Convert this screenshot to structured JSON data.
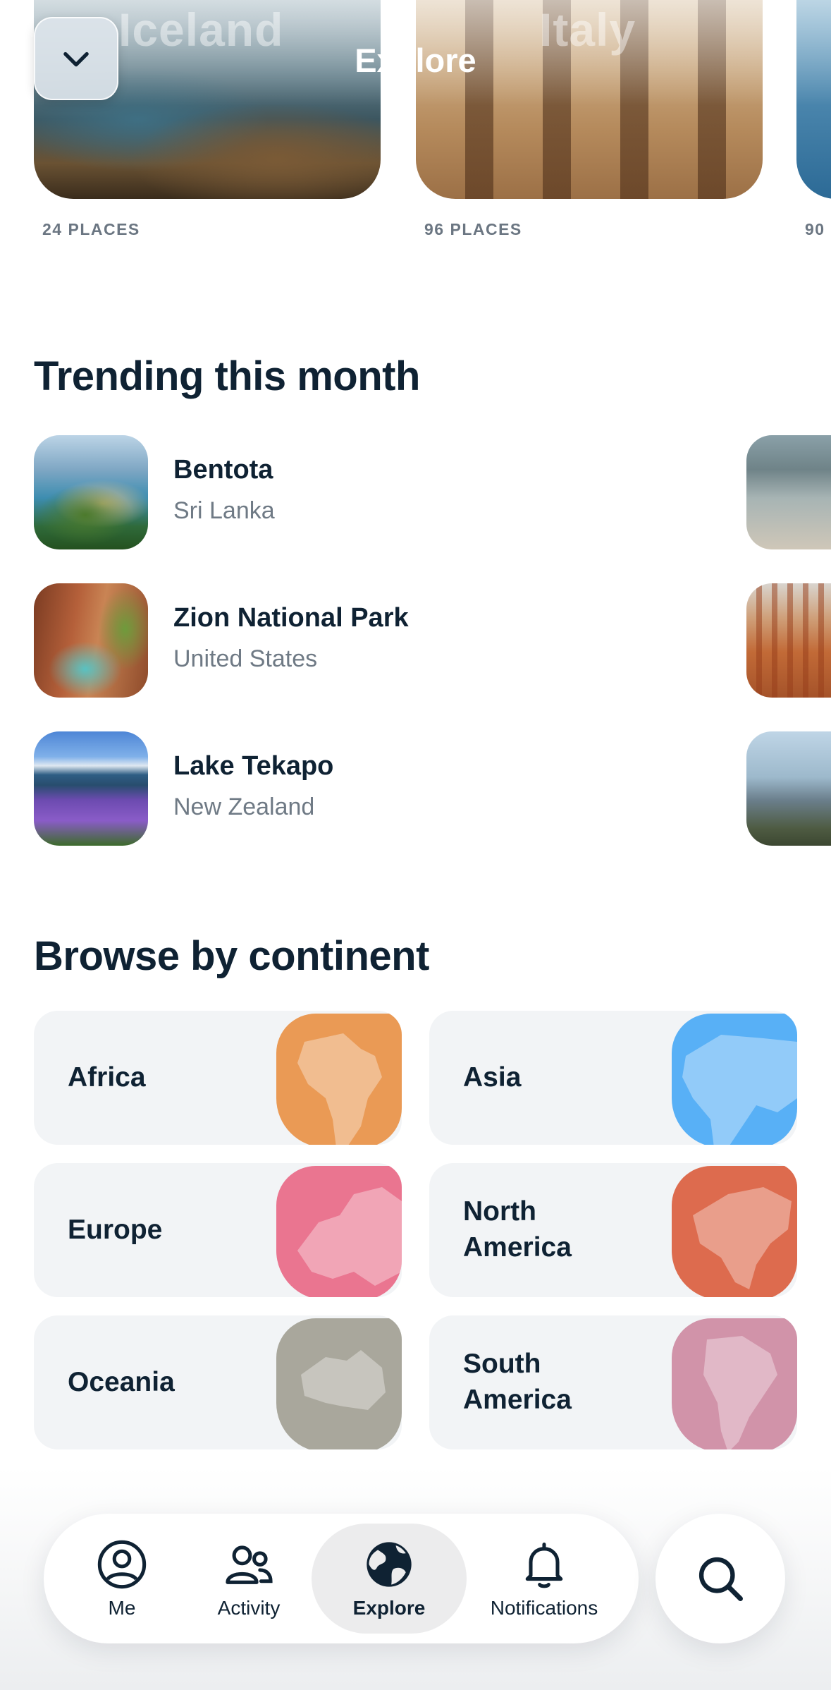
{
  "header": {
    "title": "Explore",
    "collapse_icon": "chevron-down-icon"
  },
  "countries": [
    {
      "name": "Iceland",
      "places": "24 PLACES"
    },
    {
      "name": "Italy",
      "places": "96 PLACES"
    },
    {
      "name": "",
      "places": "90"
    }
  ],
  "trending": {
    "heading": "Trending this month",
    "items": [
      {
        "name": "Bentota",
        "country": "Sri Lanka"
      },
      {
        "name": "Zion National Park",
        "country": "United States"
      },
      {
        "name": "Lake Tekapo",
        "country": "New Zealand"
      }
    ]
  },
  "continents": {
    "heading": "Browse by continent",
    "items": [
      {
        "label": "Africa",
        "color": "#ea9a55"
      },
      {
        "label": "Asia",
        "color": "#58b0f6"
      },
      {
        "label": "Europe",
        "color": "#ea7590"
      },
      {
        "label": "North America",
        "color": "#dd6b4e"
      },
      {
        "label": "Oceania",
        "color": "#a9a79c"
      },
      {
        "label": "South America",
        "color": "#d193a9"
      }
    ]
  },
  "tab_bar": {
    "items": [
      {
        "label": "Me",
        "icon": "user-circle-icon"
      },
      {
        "label": "Activity",
        "icon": "users-icon"
      },
      {
        "label": "Explore",
        "icon": "globe-icon",
        "active": true
      },
      {
        "label": "Notifications",
        "icon": "bell-icon"
      }
    ],
    "search_icon": "search-icon"
  },
  "colors": {
    "text_primary": "#0f2233",
    "text_secondary": "#6f7a85",
    "card_background": "#f2f4f6"
  }
}
